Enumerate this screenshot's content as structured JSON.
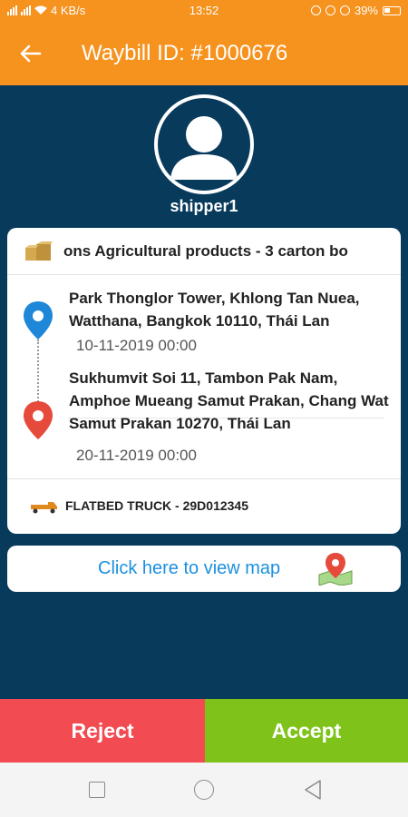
{
  "status_bar": {
    "network_speed": "4 KB/s",
    "time": "13:52",
    "battery": "39%"
  },
  "app_bar": {
    "title": "Waybill ID: #1000676",
    "back_icon": "arrow-left-icon"
  },
  "profile": {
    "username": "shipper1",
    "avatar_icon": "user-avatar-icon"
  },
  "order": {
    "goods": "ons Agricultural products - 3 carton bo",
    "goods_icon": "box-icon",
    "pickup": {
      "address": "Park Thonglor Tower, Khlong Tan Nuea, Watthana, Bangkok 10110, Thái Lan",
      "date": "10-11-2019 00:00",
      "pin_color": "#1f87d8"
    },
    "dropoff": {
      "address": "Sukhumvit Soi 11, Tambon Pak Nam, Amphoe Mueang Samut Prakan, Chang Wat Samut Prakan 10270, Thái Lan",
      "date": "20-11-2019 00:00",
      "pin_color": "#e64a3b"
    },
    "vehicle": "FLATBED TRUCK - 29D012345",
    "vehicle_icon": "truck-icon"
  },
  "map_button": {
    "label": "Click here to view map",
    "icon": "map-pin-icon"
  },
  "actions": {
    "reject_label": "Reject",
    "accept_label": "Accept"
  },
  "colors": {
    "primary": "#f6921e",
    "background": "#083a5c",
    "reject": "#f24b52",
    "accept": "#7fc31a",
    "link": "#1b8fe0"
  }
}
